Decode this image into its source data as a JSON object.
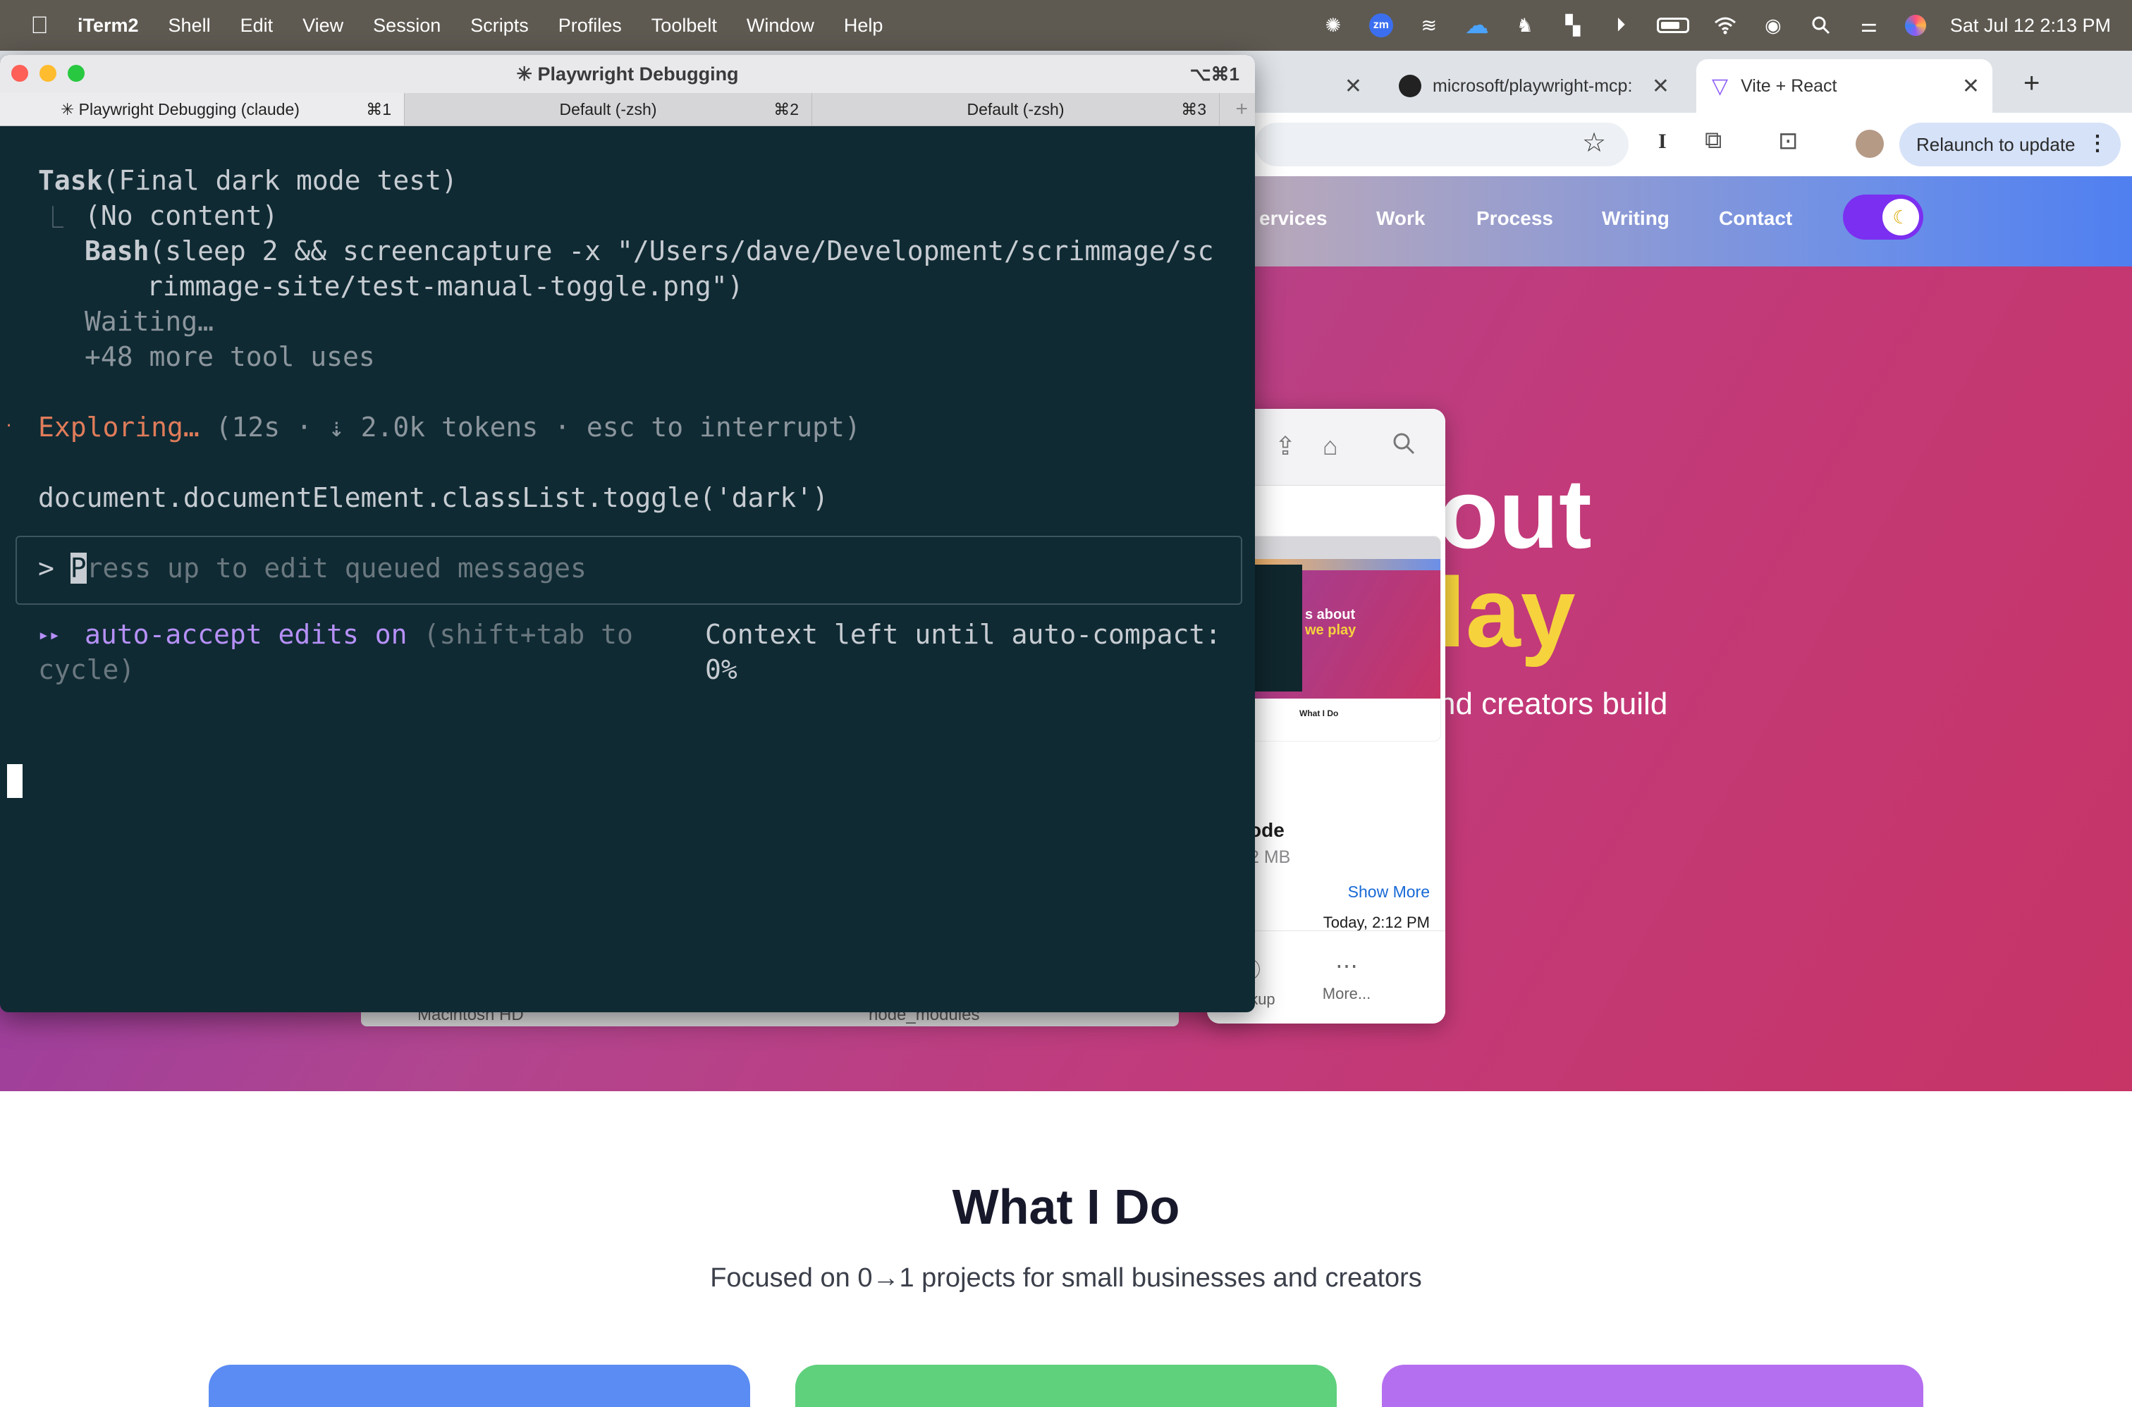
{
  "menubar": {
    "app_name": "iTerm2",
    "items": [
      "Shell",
      "Edit",
      "View",
      "Session",
      "Scripts",
      "Profiles",
      "Toolbelt",
      "Window",
      "Help"
    ],
    "clock": "Sat Jul 12  2:13 PM",
    "zoom_badge": "zm"
  },
  "browser": {
    "tabs": [
      {
        "label": "",
        "icon": "close-icon"
      },
      {
        "label": "microsoft/playwright-mcp:",
        "icon": "github-icon"
      },
      {
        "label": "Vite + React",
        "icon": "vite-icon"
      }
    ],
    "relaunch_label": "Relaunch to update",
    "nav": [
      "ervices",
      "Work",
      "Process",
      "Writing",
      "Contact"
    ],
    "hero": {
      "line1": "out",
      "line2": "lay",
      "sub": "nd creators build"
    },
    "section_title": "What I Do",
    "section_sub": "Focused on 0→1 projects for small businesses and creators",
    "card_colors": [
      "#5b8cf3",
      "#5fd07c",
      "#b46ff0"
    ]
  },
  "finder": {
    "strip_left": "Macintosh HD",
    "strip_right": "node_modules"
  },
  "quicklook": {
    "thumb_line1": "s about",
    "thumb_line2": "we play",
    "thumb_caption": "What I Do",
    "file_name": "ode",
    "file_size": "2 MB",
    "show_more": "Show More",
    "date": "Today, 2:12 PM",
    "actions": [
      {
        "label": "Markup",
        "icon": "markup-icon"
      },
      {
        "label": "More...",
        "icon": "more-icon"
      }
    ]
  },
  "terminal": {
    "title": "✳ Playwright Debugging",
    "title_shortcut": "⌥⌘1",
    "tabs": [
      {
        "label": "✳ Playwright Debugging (claude)",
        "shortcut": "⌘1"
      },
      {
        "label": "Default (-zsh)",
        "shortcut": "⌘2"
      },
      {
        "label": "Default (-zsh)",
        "shortcut": "⌘3"
      }
    ],
    "task_name": "Task",
    "task_arg": "(Final dark mode test)",
    "no_content": "(No content)",
    "bash_name": "Bash",
    "bash_line1": "(sleep 2 && screencapture -x \"/Users/dave/Development/scrimmage/sc",
    "bash_line2": "rimmage-site/test-manual-toggle.png\")",
    "waiting": "Waiting…",
    "more_tools": "+48 more tool uses",
    "exploring": "Exploring…",
    "exploring_meta": "(12s · ⇣ 2.0k tokens · esc to interrupt)",
    "queued_cmd": "document.documentElement.classList.toggle('dark')",
    "prompt_char": ">",
    "placeholder_first": "P",
    "placeholder_rest": "ress up to edit queued messages",
    "auto_accept_arrows": "▸▸",
    "auto_accept": "auto-accept edits on",
    "auto_accept_hint1": "(shift+tab to",
    "auto_accept_hint2": "cycle)",
    "context_line1": "Context left until auto-compact:",
    "context_line2": "0%"
  }
}
